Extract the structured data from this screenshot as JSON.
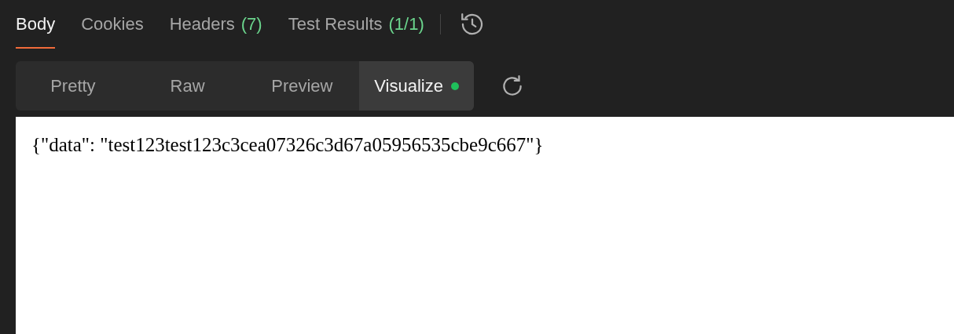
{
  "tabs": [
    {
      "label": "Body",
      "selected": true
    },
    {
      "label": "Cookies",
      "selected": false
    },
    {
      "label": "Headers",
      "count": "(7)",
      "selected": false
    },
    {
      "label": "Test Results",
      "count": "(1/1)",
      "selected": false
    }
  ],
  "view_modes": [
    {
      "label": "Pretty",
      "selected": false,
      "dot": false
    },
    {
      "label": "Raw",
      "selected": false,
      "dot": false
    },
    {
      "label": "Preview",
      "selected": false,
      "dot": false
    },
    {
      "label": "Visualize",
      "selected": true,
      "dot": true
    }
  ],
  "output": "{\"data\": \"test123test123c3cea07326c3d67a05956535cbe9c667\"}"
}
